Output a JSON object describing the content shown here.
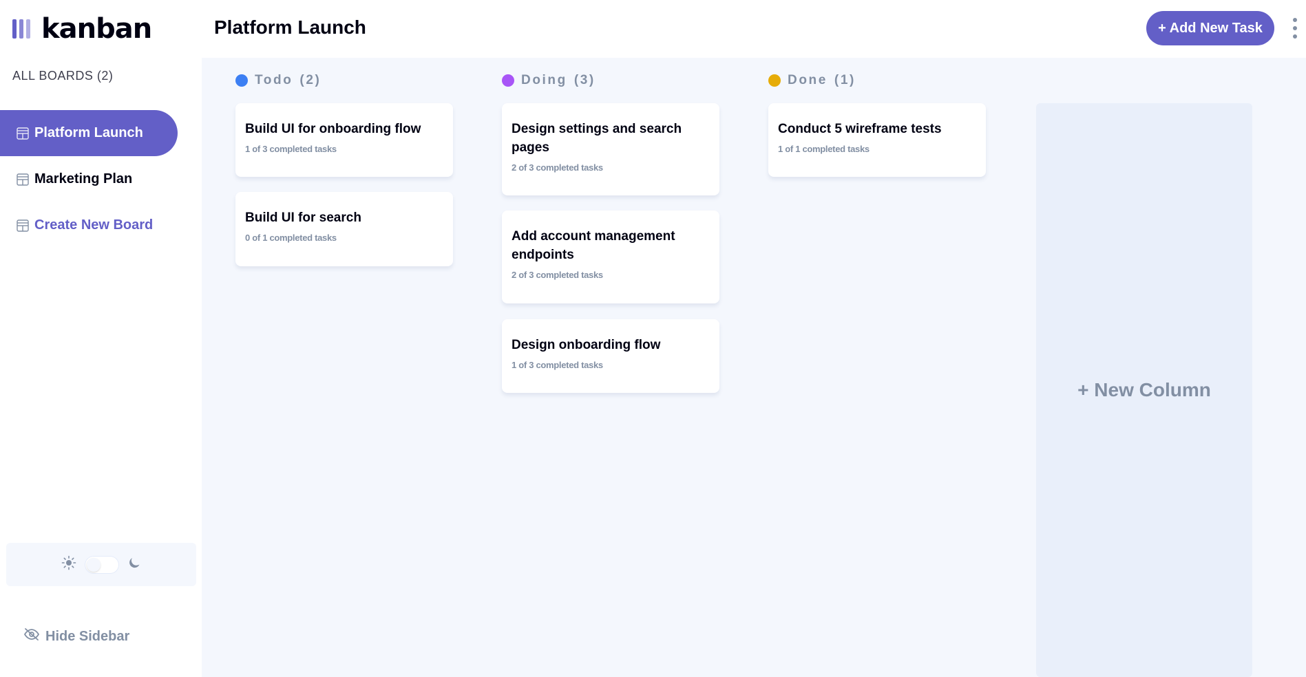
{
  "app": {
    "logo_text": "kanban"
  },
  "sidebar": {
    "heading": "ALL BOARDS (2)",
    "boards": [
      {
        "label": "Platform Launch",
        "active": true
      },
      {
        "label": "Marketing Plan",
        "active": false
      }
    ],
    "create_label": "Create New Board",
    "hide_label": "Hide Sidebar",
    "theme": {
      "mode": "light"
    }
  },
  "header": {
    "title": "Platform Launch",
    "add_task_label": "+ Add New Task"
  },
  "columns": [
    {
      "name": "Todo",
      "count": "(2)",
      "color": "#3c7ff3",
      "cards": [
        {
          "title": "Build UI for onboarding flow",
          "subtitle": "1 of 3 completed tasks"
        },
        {
          "title": "Build UI for search",
          "subtitle": "0 of 1 completed tasks"
        }
      ]
    },
    {
      "name": "Doing",
      "count": "(3)",
      "color": "#a855f7",
      "cards": [
        {
          "title": "Design settings and search pages",
          "subtitle": "2 of 3 completed tasks"
        },
        {
          "title": "Add account management endpoints",
          "subtitle": "2 of 3 completed tasks"
        },
        {
          "title": "Design onboarding flow",
          "subtitle": "1 of 3 completed tasks"
        }
      ]
    },
    {
      "name": "Done",
      "count": "(1)",
      "color": "#e6ac08",
      "cards": [
        {
          "title": "Conduct 5 wireframe tests",
          "subtitle": "1 of 1 completed tasks"
        }
      ]
    }
  ],
  "new_column_label": "+ New Column",
  "colors": {
    "accent": "#635fc7",
    "background": "#f4f7fd",
    "muted": "#828fa3"
  }
}
